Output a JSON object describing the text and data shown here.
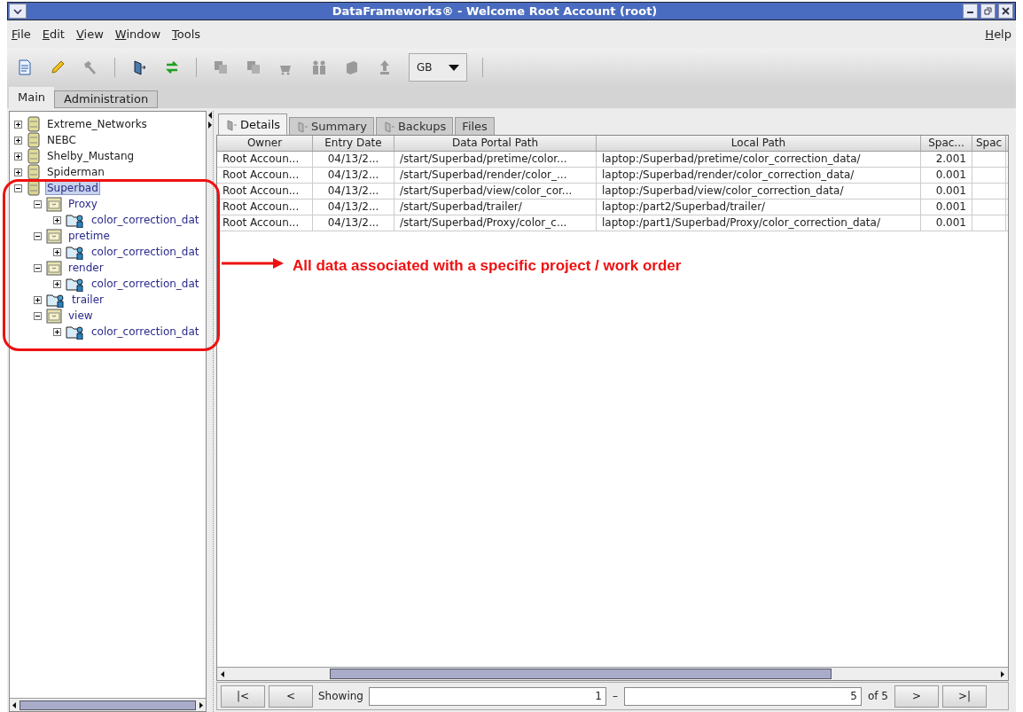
{
  "window": {
    "title": "DataFrameworks® - Welcome Root Account (root)"
  },
  "menu": [
    "File",
    "Edit",
    "View",
    "Window",
    "Tools"
  ],
  "help_menu": "Help",
  "toolbar": [
    {
      "kind": "new",
      "disabled": false
    },
    {
      "kind": "edit",
      "disabled": false
    },
    {
      "kind": "hammer",
      "disabled": true
    },
    {
      "kind": "separator"
    },
    {
      "kind": "move",
      "disabled": false
    },
    {
      "kind": "sync",
      "disabled": false
    },
    {
      "kind": "separator"
    },
    {
      "kind": "copy",
      "disabled": true
    },
    {
      "kind": "copy",
      "disabled": true
    },
    {
      "kind": "cart",
      "disabled": true
    },
    {
      "kind": "people",
      "disabled": true
    },
    {
      "kind": "drive",
      "disabled": true
    },
    {
      "kind": "upload",
      "disabled": true
    }
  ],
  "unit_dropdown": {
    "value": "GB"
  },
  "main_tabs": [
    {
      "label": "Main",
      "selected": true
    },
    {
      "label": "Administration",
      "selected": false
    }
  ],
  "tree": [
    {
      "label": "Extreme_Networks",
      "kind": "project",
      "expanded": false,
      "selected": false
    },
    {
      "label": "NEBC",
      "kind": "project",
      "expanded": false,
      "selected": false
    },
    {
      "label": "Shelby_Mustang",
      "kind": "project",
      "expanded": false,
      "selected": false
    },
    {
      "label": "Spiderman",
      "kind": "project",
      "expanded": false,
      "selected": false
    },
    {
      "label": "Superbad",
      "kind": "project",
      "expanded": true,
      "selected": true,
      "children": [
        {
          "label": "Proxy",
          "kind": "folder",
          "expanded": true,
          "selected": false,
          "children": [
            {
              "label": "color_correction_dat",
              "kind": "shared",
              "expanded": false,
              "selected": false
            }
          ]
        },
        {
          "label": "pretime",
          "kind": "folder",
          "expanded": true,
          "selected": false,
          "children": [
            {
              "label": "color_correction_dat",
              "kind": "shared",
              "expanded": false,
              "selected": false
            }
          ]
        },
        {
          "label": "render",
          "kind": "folder",
          "expanded": true,
          "selected": false,
          "children": [
            {
              "label": "color_correction_dat",
              "kind": "shared",
              "expanded": false,
              "selected": false
            }
          ]
        },
        {
          "label": "trailer",
          "kind": "shared",
          "expanded": false,
          "selected": false
        },
        {
          "label": "view",
          "kind": "folder",
          "expanded": true,
          "selected": false,
          "children": [
            {
              "label": "color_correction_dat",
              "kind": "shared",
              "expanded": false,
              "selected": false
            }
          ]
        }
      ]
    }
  ],
  "detail_tabs": [
    {
      "label": "Details",
      "selected": true,
      "has_icon": true
    },
    {
      "label": "Summary",
      "selected": false,
      "has_icon": true
    },
    {
      "label": "Backups",
      "selected": false,
      "has_icon": true
    },
    {
      "label": "Files",
      "selected": false,
      "has_icon": false
    }
  ],
  "table": {
    "columns": [
      "Owner",
      "Entry Date",
      "Data Portal Path",
      "Local Path",
      "Spac...",
      "Spac"
    ],
    "rows": [
      [
        "Root Accoun...",
        "04/13/2...",
        "/start/Superbad/pretime/color...",
        "laptop:/Superbad/pretime/color_correction_data/",
        "2.001"
      ],
      [
        "Root Accoun...",
        "04/13/2...",
        "/start/Superbad/render/color_...",
        "laptop:/Superbad/render/color_correction_data/",
        "0.001"
      ],
      [
        "Root Accoun...",
        "04/13/2...",
        "/start/Superbad/view/color_cor...",
        "laptop:/Superbad/view/color_correction_data/",
        "0.001"
      ],
      [
        "Root Accoun...",
        "04/13/2...",
        "/start/Superbad/trailer/",
        "laptop:/part2/Superbad/trailer/",
        "0.001"
      ],
      [
        "Root Accoun...",
        "04/13/2...",
        "/start/Superbad/Proxy/color_c...",
        "laptop:/part1/Superbad/Proxy/color_correction_data/",
        "0.001"
      ]
    ]
  },
  "pager": {
    "first": "|<",
    "prev": "<",
    "showing": "Showing",
    "from": "1",
    "dash": "–",
    "to": "5",
    "total": "of 5",
    "next": ">",
    "last": ">|"
  },
  "annotation": {
    "text": "All data associated with a specific project / work order"
  }
}
